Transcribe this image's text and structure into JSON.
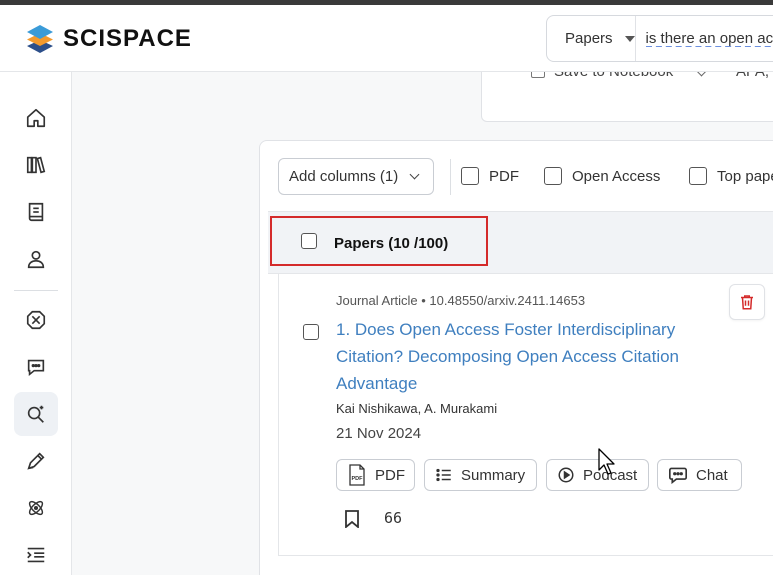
{
  "app": {
    "brand": "SCISPACE",
    "logo_colors": {
      "top": "#3a9bd8",
      "middle": "#f39a2e",
      "bottom": "#2c4f8a"
    }
  },
  "search": {
    "mode": "Papers",
    "query": "is there an open access citation advantage"
  },
  "sidebar": {
    "items": [
      {
        "name": "home-icon",
        "active": false
      },
      {
        "name": "library-icon",
        "active": false
      },
      {
        "name": "notebook-icon",
        "active": false
      },
      {
        "name": "user-icon",
        "active": false
      },
      {
        "name": "integrations-icon",
        "active": false
      },
      {
        "name": "chat-icon",
        "active": false
      },
      {
        "name": "literature-search-icon",
        "active": true
      },
      {
        "name": "ai-writer-icon",
        "active": false
      },
      {
        "name": "math-icon",
        "active": false
      },
      {
        "name": "outline-icon",
        "active": false
      }
    ]
  },
  "notebook_card": {
    "save_label": "Save to Notebook",
    "cite_label": "APA,"
  },
  "filters": {
    "add_columns": "Add columns (1)",
    "options": [
      "PDF",
      "Open Access",
      "Top papers"
    ]
  },
  "table": {
    "header": "Papers (10 /100)",
    "highlight_color": "#d42a2a"
  },
  "paper": {
    "meta": "Journal Article • 10.48550/arxiv.2411.14653",
    "title": "1. Does Open Access Foster Interdisciplinary Citation? Decomposing Open Access Citation Advantage",
    "authors": "Kai Nishikawa, A. Murakami",
    "date": "21 Nov 2024",
    "citations": "66",
    "title_color": "#3f7fbf",
    "actions": {
      "pdf": "PDF",
      "summary": "Summary",
      "podcast": "Podcast",
      "chat": "Chat"
    }
  }
}
